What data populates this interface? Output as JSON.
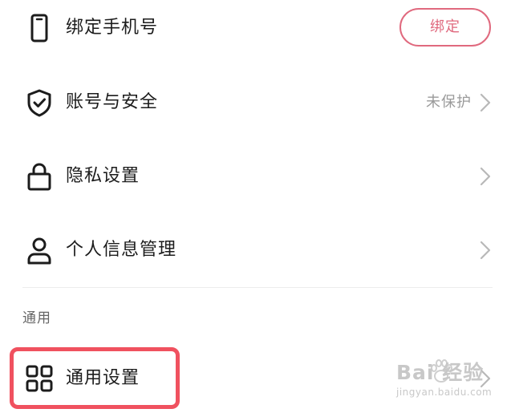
{
  "rows": [
    {
      "label": "绑定手机号",
      "icon": "phone-icon",
      "button": "绑定"
    },
    {
      "label": "账号与安全",
      "icon": "shield-check-icon",
      "status": "未保护"
    },
    {
      "label": "隐私设置",
      "icon": "lock-icon"
    },
    {
      "label": "个人信息管理",
      "icon": "person-icon"
    }
  ],
  "section": {
    "title": "通用"
  },
  "general": {
    "label": "通用设置",
    "icon": "grid-icon"
  },
  "watermark": {
    "brand": "Bai 经验",
    "url": "jingyan.baidu.com"
  },
  "colors": {
    "accent": "#e0697e",
    "highlight": "#f0515f",
    "muted": "#9a9a9a"
  }
}
